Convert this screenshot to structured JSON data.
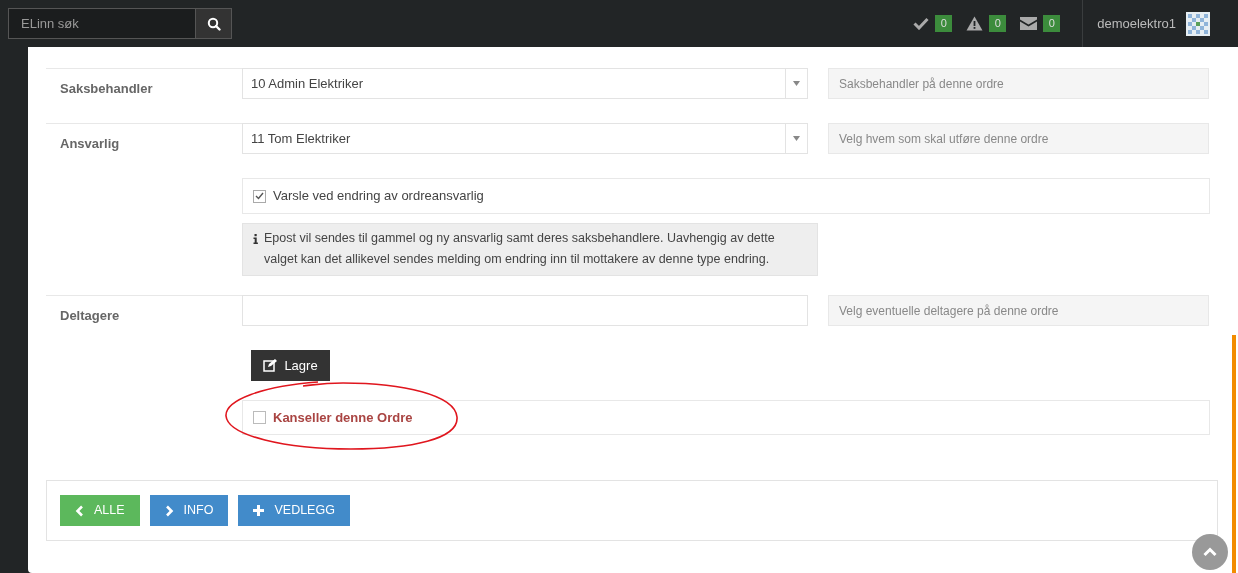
{
  "topbar": {
    "search": {
      "placeholder": "ELinn søk"
    },
    "counters": [
      {
        "kind": "check",
        "count": "0"
      },
      {
        "kind": "warning",
        "count": "0"
      },
      {
        "kind": "mail",
        "count": "0"
      }
    ],
    "user": "demoelektro1"
  },
  "fields": [
    {
      "kind": "select",
      "label": "Saksbehandler",
      "value": "10 Admin Elektriker",
      "hint": "Saksbehandler på denne ordre"
    },
    {
      "kind": "select",
      "label": "Ansvarlig",
      "value": "11 Tom Elektriker",
      "hint": "Velg hvem som skal utføre denne ordre"
    },
    {
      "kind": "checkbox",
      "label": "Varsle ved endring av ordreansvarlig",
      "checked": true
    },
    {
      "kind": "info",
      "text": "Epost vil sendes til gammel og ny ansvarlig samt deres saksbehandlere. Uavhengig av dette valget kan det allikevel sendes melding om endring inn til mottakere av denne type endring."
    },
    {
      "kind": "text",
      "label": "Deltagere",
      "hint": "Velg eventuelle deltagere på denne ordre"
    }
  ],
  "save_button": "Lagre",
  "cancel": {
    "label": "Kanseller denne Ordre",
    "checked": false
  },
  "nav_buttons": [
    {
      "kind": "back",
      "label": "ALLE",
      "color": "#5cb85c"
    },
    {
      "kind": "forward",
      "label": "INFO",
      "color": "#428bca"
    },
    {
      "kind": "add",
      "label": "VEDLEGG",
      "color": "#428bca"
    }
  ]
}
